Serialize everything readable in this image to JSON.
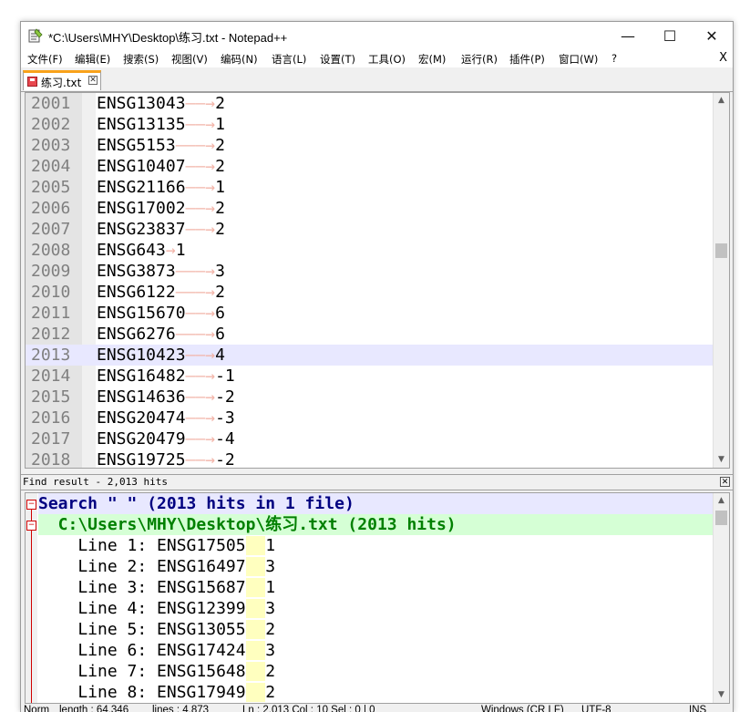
{
  "window": {
    "title": "*C:\\Users\\MHY\\Desktop\\练习.txt - Notepad++",
    "minimize": "—",
    "maximize": "☐",
    "close": "✕"
  },
  "menu": {
    "items": [
      "文件(F)",
      "编辑(E)",
      "搜索(S)",
      "视图(V)",
      "编码(N)",
      "语言(L)",
      "设置(T)",
      "工具(O)",
      "宏(M)",
      "运行(R)",
      "插件(P)",
      "窗口(W)",
      "?"
    ],
    "close": "X"
  },
  "tab": {
    "label": "练习.txt",
    "close": "✕"
  },
  "editor": {
    "current_line": "2013",
    "lines": [
      {
        "num": "2001",
        "id": "ENSG13043",
        "tab": "——→",
        "val": "2"
      },
      {
        "num": "2002",
        "id": "ENSG13135",
        "tab": "——→",
        "val": "1"
      },
      {
        "num": "2003",
        "id": "ENSG5153",
        "tab": "———→",
        "val": "2"
      },
      {
        "num": "2004",
        "id": "ENSG10407",
        "tab": "——→",
        "val": "2"
      },
      {
        "num": "2005",
        "id": "ENSG21166",
        "tab": "——→",
        "val": "1"
      },
      {
        "num": "2006",
        "id": "ENSG17002",
        "tab": "——→",
        "val": "2"
      },
      {
        "num": "2007",
        "id": "ENSG23837",
        "tab": "——→",
        "val": "2"
      },
      {
        "num": "2008",
        "id": "ENSG643",
        "tab": "→",
        "val": "1"
      },
      {
        "num": "2009",
        "id": "ENSG3873",
        "tab": "———→",
        "val": "3"
      },
      {
        "num": "2010",
        "id": "ENSG6122",
        "tab": "———→",
        "val": "2"
      },
      {
        "num": "2011",
        "id": "ENSG15670",
        "tab": "——→",
        "val": "6"
      },
      {
        "num": "2012",
        "id": "ENSG6276",
        "tab": "———→",
        "val": "6"
      },
      {
        "num": "2013",
        "id": "ENSG10423",
        "tab": "——→",
        "val": "4"
      },
      {
        "num": "2014",
        "id": "ENSG16482",
        "tab": "——→",
        "val": "-1"
      },
      {
        "num": "2015",
        "id": "ENSG14636",
        "tab": "——→",
        "val": "-2"
      },
      {
        "num": "2016",
        "id": "ENSG20474",
        "tab": "——→",
        "val": "-3"
      },
      {
        "num": "2017",
        "id": "ENSG20479",
        "tab": "——→",
        "val": "-4"
      },
      {
        "num": "2018",
        "id": "ENSG19725",
        "tab": "——→",
        "val": "-2"
      }
    ]
  },
  "find": {
    "header": "Find result - 2,013 hits",
    "close": "✕",
    "search_line": "Search \" \" (2013 hits in 1 file)",
    "file_line": "  C:\\Users\\MHY\\Desktop\\练习.txt (2013 hits)",
    "hits": [
      {
        "prefix": "    Line 1: ",
        "id": "ENSG17505",
        "val": "1"
      },
      {
        "prefix": "    Line 2: ",
        "id": "ENSG16497",
        "val": "3"
      },
      {
        "prefix": "    Line 3: ",
        "id": "ENSG15687",
        "val": "1"
      },
      {
        "prefix": "    Line 4: ",
        "id": "ENSG12399",
        "val": "3"
      },
      {
        "prefix": "    Line 5: ",
        "id": "ENSG13055",
        "val": "2"
      },
      {
        "prefix": "    Line 6: ",
        "id": "ENSG17424",
        "val": "3"
      },
      {
        "prefix": "    Line 7: ",
        "id": "ENSG15648",
        "val": "2"
      },
      {
        "prefix": "    Line 8: ",
        "id": "ENSG17949",
        "val": "2"
      }
    ]
  },
  "status": {
    "type": "Norm",
    "length": "length : 64,346",
    "lines": "lines : 4,873",
    "position": "Ln : 2,013    Col : 10    Sel : 0 | 0",
    "eol": "Windows (CR LF)",
    "encoding": "UTF-8",
    "mode": "INS"
  },
  "colors": {
    "accent_tab": "#f9a21a",
    "current_line": "#e8e8ff",
    "file_line_bg": "#d5ffd5",
    "search_text": "#000080"
  }
}
